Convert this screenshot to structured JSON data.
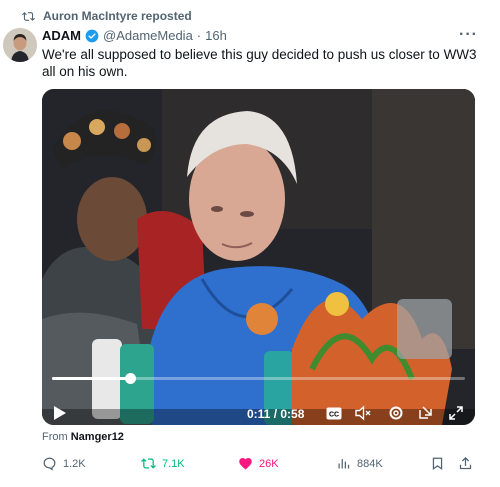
{
  "repost": {
    "text": "Auron MacIntyre reposted",
    "icon": "repost-icon"
  },
  "tweet": {
    "author_name": "ADAM",
    "handle": "@AdameMedia",
    "separator": "·",
    "time": "16h",
    "more": "···",
    "text": "We're all supposed to believe this guy decided to push us closer to WW3 all on his own.",
    "verified_color": "#1d9bf0"
  },
  "video": {
    "time_display": "0:11 / 0:58",
    "progress": 0.19,
    "cc_label": "CC"
  },
  "source": {
    "prefix": "From",
    "name": "Namger12"
  },
  "actions": {
    "replies": "1.2K",
    "reposts": "7.1K",
    "likes": "26K",
    "views": "884K",
    "repost_color": "#00ba7c",
    "like_color": "#f91880"
  }
}
